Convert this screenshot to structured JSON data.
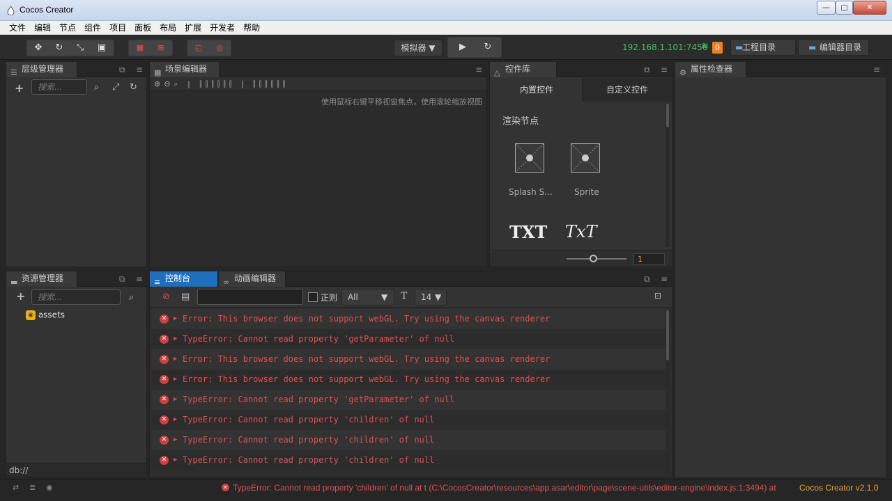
{
  "window": {
    "title": "Cocos Creator",
    "min": "—",
    "max": "▢",
    "close": "✕"
  },
  "menu": [
    "文件",
    "编辑",
    "节点",
    "组件",
    "项目",
    "面板",
    "布局",
    "扩展",
    "开发者",
    "帮助"
  ],
  "toolbar": {
    "simulator": "模拟器 ▼",
    "ip": "192.168.1.101:7456",
    "count": "0",
    "project_dir": "工程目录",
    "editor_dir": "编辑器目录"
  },
  "hierarchy": {
    "title": "层级管理器",
    "search_placeholder": "搜索..."
  },
  "scene": {
    "title": "场景编辑器",
    "hint": "使用鼠标右键平移视窗焦点，使用滚轮缩放视图"
  },
  "library": {
    "title": "控件库",
    "tab_builtin": "内置控件",
    "tab_custom": "自定义控件",
    "section": "渲染节点",
    "items": [
      "Splash S...",
      "Sprite"
    ],
    "txt1": "TXT",
    "txt2": "TxT",
    "zoom": "1"
  },
  "inspector": {
    "title": "属性检查器"
  },
  "assets": {
    "title": "资源管理器",
    "search_placeholder": "搜索...",
    "root": "assets",
    "footer": "db://"
  },
  "console": {
    "tab_console": "控制台",
    "tab_anim": "动画编辑器",
    "regex": "正则",
    "filter": "All",
    "fontsize": "14",
    "logs": [
      "Error: This browser does not support webGL. Try using the canvas renderer",
      "TypeError: Cannot read property 'getParameter' of null",
      "Error: This browser does not support webGL. Try using the canvas renderer",
      "Error: This browser does not support webGL. Try using the canvas renderer",
      "TypeError: Cannot read property 'getParameter' of null",
      "TypeError: Cannot read property 'children' of null",
      "TypeError: Cannot read property 'children' of null",
      "TypeError: Cannot read property 'children' of null"
    ]
  },
  "status": {
    "error": "TypeError: Cannot read property 'children' of null at t (C:\\CocosCreator\\resources\\app.asar\\editor\\page\\scene-utils\\editor-engine\\index.js:1:3494) at",
    "version": "Cocos Creator v2.1.0"
  },
  "colors": {
    "accent": "#1f6fbf",
    "error": "#e05050",
    "ip": "#3fc35a",
    "badge": "#f08020",
    "version": "#f0a030"
  }
}
